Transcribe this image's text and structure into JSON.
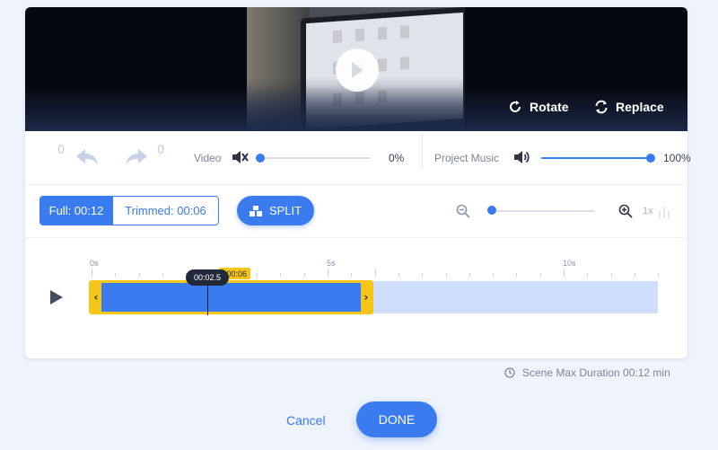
{
  "preview": {
    "rotate_label": "Rotate",
    "replace_label": "Replace"
  },
  "history": {
    "undo_count": "0",
    "redo_count": "0"
  },
  "video_audio": {
    "label": "Video",
    "volume_text": "0%",
    "volume": 0
  },
  "music_audio": {
    "label": "Project Music",
    "volume_text": "100%",
    "volume": 1
  },
  "trim_tabs": {
    "full_label": "Full: 00:12",
    "trimmed_label": "Trimmed: 00:06"
  },
  "split_label": "SPLIT",
  "zoom": {
    "level_label": "1x",
    "value": 0
  },
  "timeline": {
    "ruler_labels": [
      "0s",
      "5s",
      "10s"
    ],
    "playhead_time": "00:02.5",
    "trim_end_time": "00:06"
  },
  "scene_max_duration": "Scene Max Duration 00:12 min",
  "footer": {
    "cancel_label": "Cancel",
    "done_label": "DONE"
  },
  "colors": {
    "accent": "#3a7cf0",
    "trim_handle": "#f5c518",
    "background": "#eef3fc"
  }
}
